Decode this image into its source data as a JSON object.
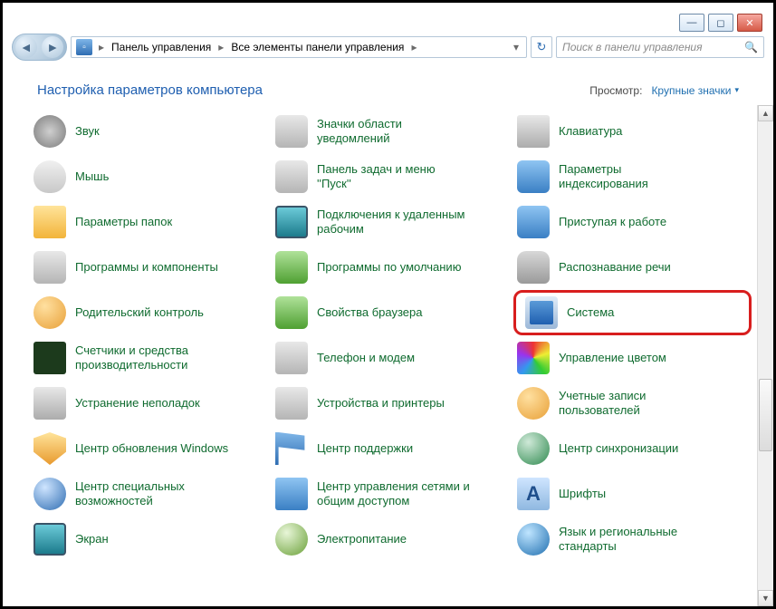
{
  "breadcrumb": {
    "seg1": "Панель управления",
    "seg2": "Все элементы панели управления"
  },
  "search": {
    "placeholder": "Поиск в панели управления"
  },
  "header": {
    "title": "Настройка параметров компьютера",
    "view_label": "Просмотр:",
    "view_value": "Крупные значки"
  },
  "items": [
    {
      "label": "Звук",
      "icon": "ic-speaker",
      "name": "sound"
    },
    {
      "label": "Значки области уведомлений",
      "icon": "ic-gray",
      "name": "notification-area-icons"
    },
    {
      "label": "Клавиатура",
      "icon": "ic-keyboard",
      "name": "keyboard"
    },
    {
      "label": "Мышь",
      "icon": "ic-mouse",
      "name": "mouse"
    },
    {
      "label": "Панель задач и меню ''Пуск''",
      "icon": "ic-gray",
      "name": "taskbar-startmenu"
    },
    {
      "label": "Параметры индексирования",
      "icon": "ic-blue",
      "name": "indexing-options"
    },
    {
      "label": "Параметры папок",
      "icon": "ic-folder",
      "name": "folder-options"
    },
    {
      "label": "Подключения к удаленным рабочим",
      "icon": "ic-screen",
      "name": "remote-desktop"
    },
    {
      "label": "Приступая к работе",
      "icon": "ic-blue",
      "name": "getting-started"
    },
    {
      "label": "Программы и компоненты",
      "icon": "ic-gray",
      "name": "programs-features"
    },
    {
      "label": "Программы по умолчанию",
      "icon": "ic-green",
      "name": "default-programs"
    },
    {
      "label": "Распознавание речи",
      "icon": "ic-mic",
      "name": "speech-recognition"
    },
    {
      "label": "Родительский контроль",
      "icon": "ic-users",
      "name": "parental-controls"
    },
    {
      "label": "Свойства браузера",
      "icon": "ic-green",
      "name": "internet-options"
    },
    {
      "label": "Система",
      "icon": "ic-sys",
      "name": "system",
      "highlight": true
    },
    {
      "label": "Счетчики и средства производительности",
      "icon": "ic-chart",
      "name": "performance"
    },
    {
      "label": "Телефон и модем",
      "icon": "ic-phone",
      "name": "phone-modem"
    },
    {
      "label": "Управление цветом",
      "icon": "ic-color",
      "name": "color-management"
    },
    {
      "label": "Устранение неполадок",
      "icon": "ic-wrench",
      "name": "troubleshooting"
    },
    {
      "label": "Устройства и принтеры",
      "icon": "ic-printer",
      "name": "devices-printers"
    },
    {
      "label": "Учетные записи пользователей",
      "icon": "ic-users",
      "name": "user-accounts"
    },
    {
      "label": "Центр обновления Windows",
      "icon": "ic-shield",
      "name": "windows-update"
    },
    {
      "label": "Центр поддержки",
      "icon": "ic-flag",
      "name": "action-center"
    },
    {
      "label": "Центр синхронизации",
      "icon": "ic-sync",
      "name": "sync-center"
    },
    {
      "label": "Центр специальных возможностей",
      "icon": "ic-clock",
      "name": "ease-of-access"
    },
    {
      "label": "Центр управления сетями и общим доступом",
      "icon": "ic-net",
      "name": "network-sharing"
    },
    {
      "label": "Шрифты",
      "icon": "ic-font",
      "name": "fonts",
      "glyph": "A"
    },
    {
      "label": "Экран",
      "icon": "ic-screen",
      "name": "display"
    },
    {
      "label": "Электропитание",
      "icon": "ic-power",
      "name": "power-options"
    },
    {
      "label": "Язык и региональные стандарты",
      "icon": "ic-globe",
      "name": "region-language"
    }
  ]
}
